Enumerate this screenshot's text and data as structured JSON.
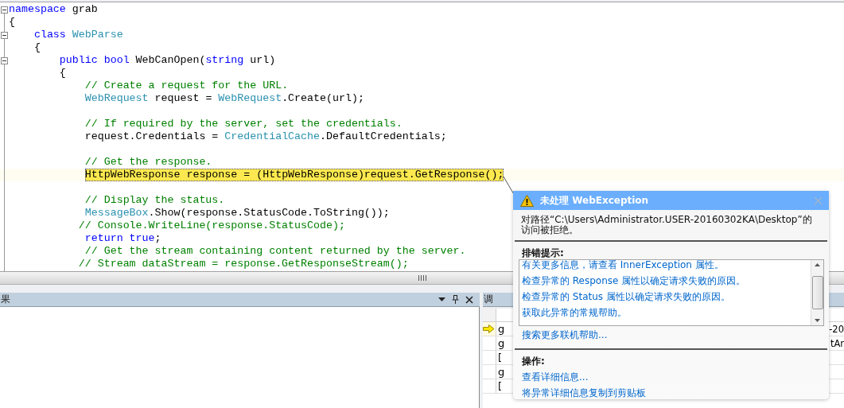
{
  "code": {
    "lines": [
      {
        "fold": true,
        "highlighted": false,
        "segments": [
          {
            "text": "namespace",
            "kind": "keyword"
          },
          {
            "text": " grab",
            "kind": "plain"
          }
        ]
      },
      {
        "fold": false,
        "highlighted": false,
        "segments": [
          {
            "text": "{",
            "kind": "plain"
          }
        ]
      },
      {
        "fold": true,
        "highlighted": false,
        "segments": [
          {
            "text": "    class",
            "kind": "keyword"
          },
          {
            "text": " WebParse",
            "kind": "type"
          }
        ]
      },
      {
        "fold": false,
        "highlighted": false,
        "segments": [
          {
            "text": "    {",
            "kind": "plain"
          }
        ]
      },
      {
        "fold": true,
        "highlighted": false,
        "segments": [
          {
            "text": "        public bool",
            "kind": "keyword"
          },
          {
            "text": " WebCanOpen(",
            "kind": "plain"
          },
          {
            "text": "string",
            "kind": "keyword"
          },
          {
            "text": " url)",
            "kind": "plain"
          }
        ]
      },
      {
        "fold": false,
        "highlighted": false,
        "segments": [
          {
            "text": "        {",
            "kind": "plain"
          }
        ]
      },
      {
        "fold": false,
        "highlighted": false,
        "segments": [
          {
            "text": "            // Create a request for the URL.",
            "kind": "comment"
          }
        ]
      },
      {
        "fold": false,
        "highlighted": false,
        "segments": [
          {
            "text": "            WebRequest",
            "kind": "type"
          },
          {
            "text": " request = ",
            "kind": "plain"
          },
          {
            "text": "WebRequest",
            "kind": "type"
          },
          {
            "text": ".Create(url);",
            "kind": "plain"
          }
        ]
      },
      {
        "fold": false,
        "highlighted": false
      },
      {
        "fold": false,
        "highlighted": false,
        "segments": [
          {
            "text": "            // If required by the server, set the credentials.",
            "kind": "comment"
          }
        ]
      },
      {
        "fold": false,
        "highlighted": false,
        "segments": [
          {
            "text": "            request.Credentials = ",
            "kind": "plain"
          },
          {
            "text": "CredentialCache",
            "kind": "type"
          },
          {
            "text": ".DefaultCredentials;",
            "kind": "plain"
          }
        ]
      },
      {
        "fold": false,
        "highlighted": false
      },
      {
        "fold": false,
        "highlighted": false,
        "segments": [
          {
            "text": "            // Get the response.",
            "kind": "comment"
          }
        ]
      },
      {
        "fold": false,
        "highlighted": true,
        "segments": [
          {
            "text": "            HttpWebResponse response = (HttpWebResponse)request.GetResponse();",
            "kind": "plain"
          }
        ]
      },
      {
        "fold": false,
        "highlighted": false
      },
      {
        "fold": false,
        "highlighted": false,
        "segments": [
          {
            "text": "            // Display the status.",
            "kind": "comment"
          }
        ]
      },
      {
        "fold": false,
        "highlighted": false,
        "segments": [
          {
            "text": "            MessageBox",
            "kind": "type"
          },
          {
            "text": ".Show(response.StatusCode.ToString());",
            "kind": "plain"
          }
        ]
      },
      {
        "fold": false,
        "highlighted": false,
        "segments": [
          {
            "text": "           // Console.WriteLine(response.StatusCode);",
            "kind": "comment"
          }
        ]
      },
      {
        "fold": false,
        "highlighted": false,
        "segments": [
          {
            "text": "            return true",
            "kind": "keyword"
          },
          {
            "text": ";",
            "kind": "plain"
          }
        ]
      },
      {
        "fold": false,
        "highlighted": false,
        "segments": [
          {
            "text": "            // Get the stream containing content returned by the server.",
            "kind": "comment"
          }
        ]
      },
      {
        "fold": false,
        "highlighted": false,
        "segments": [
          {
            "text": "           // Stream dataStream = response.GetResponseStream();",
            "kind": "comment"
          }
        ]
      }
    ]
  },
  "output_panel": {
    "title": "果"
  },
  "call_stack_panel": {
    "title": "调",
    "rows": [
      {
        "current": true,
        "column_1": "g",
        "column_2": "-20"
      },
      {
        "current": false,
        "column_1": "g",
        "column_2": "tAr"
      },
      {
        "current": false,
        "column_1": "["
      },
      {
        "current": false,
        "column_1": "g"
      },
      {
        "current": false,
        "column_1": "["
      }
    ]
  },
  "exception_popup": {
    "title": "未处理 WebException",
    "message": "对路径“C:\\Users\\Administrator.USER-20160302KA\\Desktop”的访问被拒绝。",
    "tips_heading": "排错提示:",
    "tips": [
      "有关更多信息，请查看 InnerException 属性。",
      "检查异常的 Response 属性以确定请求失败的原因。",
      "检查异常的 Status 属性以确定请求失败的原因。",
      "获取此异常的常规帮助。"
    ],
    "search_link": "搜索更多联机帮助...",
    "actions_heading": "操作:",
    "actions": [
      "查看详细信息...",
      "将异常详细信息复制到剪贴板"
    ]
  }
}
